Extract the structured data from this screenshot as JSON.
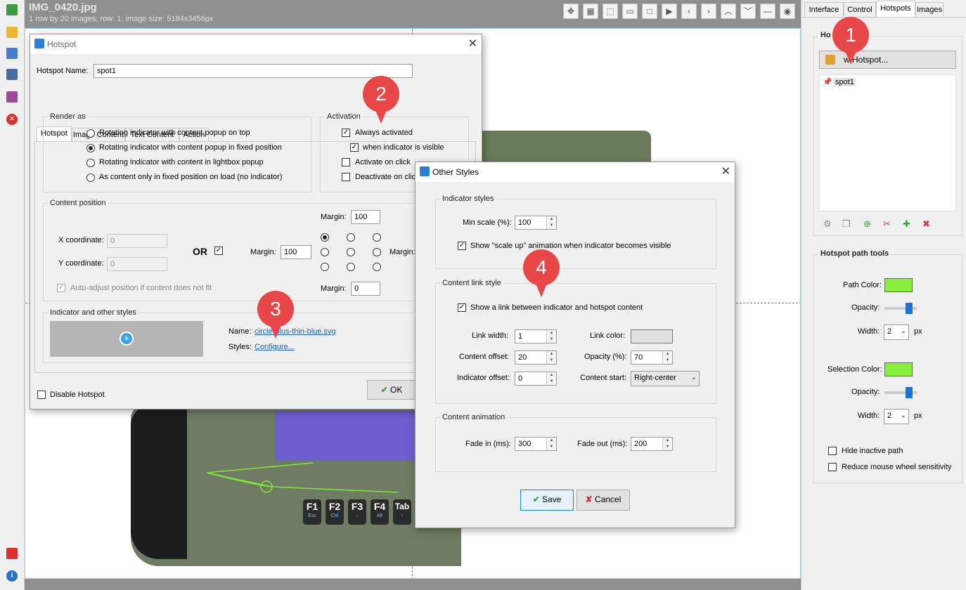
{
  "header": {
    "file_title": "IMG_0420.jpg",
    "file_info": "1 row by 20 images; row: 1; image size: 5184x3456px"
  },
  "right_panel": {
    "tabs": [
      "Interface",
      "Control",
      "Hotspots",
      "Images"
    ],
    "active_tab": "Hotspots",
    "hotspots_group_title": "Ho",
    "new_hotspot_label": "w Hotspot...",
    "hotspot_list": [
      "spot1"
    ],
    "path_tools_title": "Hotspot path tools",
    "path_color_label": "Path Color:",
    "path_color": "#86f03a",
    "opacity_label": "Opacity:",
    "width_label": "Width:",
    "path_width": "2",
    "px_label": "px",
    "selection_color_label": "Selection Color:",
    "selection_color": "#86f03a",
    "selection_width": "2",
    "hide_inactive_label": "Hide inactive path",
    "reduce_wheel_label": "Reduce mouse wheel sensitivity"
  },
  "hotspot_dialog": {
    "title": "Hotspot",
    "name_label": "Hotspot Name:",
    "name_value": "spot1",
    "tabs": [
      "Hotspot",
      "Image Content",
      "Text Content",
      "Action"
    ],
    "render_as_title": "Render as",
    "render_options": [
      "Rotating indicator with content popup on top",
      "Rotating indicator with content popup in fixed position",
      "Rotating indicator with content in lightbox popup",
      "As content only in fixed position on load (no indicator)"
    ],
    "activation_title": "Activation",
    "always_activated": "Always activated",
    "when_visible": "when indicator is visible",
    "activate_click": "Activate on click",
    "deactivate_click": "Deactivate on clic",
    "content_position_title": "Content position",
    "x_label": "X coordinate:",
    "x_value": "0",
    "y_label": "Y coordinate:",
    "y_value": "0",
    "or_label": "OR",
    "margin_label": "Margin:",
    "margin_top": "100",
    "margin_left": "100",
    "margin_bottom": "0",
    "auto_adjust": "Auto-adjust position if content does not fit",
    "indicator_title": "Indicator and other styles",
    "name_field_label": "Name:",
    "indicator_name": "circle-plus-thin-blue.svg",
    "styles_label": "Styles:",
    "configure_link": "Configure...",
    "disable_label": "Disable Hotspot",
    "ok_label": "OK"
  },
  "styles_dialog": {
    "title": "Other Styles",
    "indicator_styles_title": "Indicator styles",
    "min_scale_label": "Min scale (%):",
    "min_scale": "100",
    "scale_up_label": "Show \"scale up\" animation when indicator becomes visible",
    "content_link_title": "Content link style",
    "show_link_label": "Show a link between indicator and hotspot content",
    "link_width_label": "Link width:",
    "link_width": "1",
    "link_color_label": "Link color:",
    "content_offset_label": "Content offset:",
    "content_offset": "20",
    "opacity_label": "Opacity (%):",
    "opacity": "70",
    "indicator_offset_label": "Indicator offset:",
    "indicator_offset": "0",
    "content_start_label": "Content start:",
    "content_start": "Right-center",
    "content_animation_title": "Content animation",
    "fade_in_label": "Fade in (ms):",
    "fade_in": "300",
    "fade_out_label": "Fade out (ms):",
    "fade_out": "200",
    "save_label": "Save",
    "cancel_label": "Cancel"
  },
  "keys": [
    {
      "top": "F1",
      "sub": "Esc"
    },
    {
      "top": "F2",
      "sub": "Ctrl"
    },
    {
      "top": "F3",
      "sub": "↓"
    },
    {
      "top": "F4",
      "sub": "Alt"
    },
    {
      "top": "Tab",
      "sub": "↑"
    }
  ],
  "callouts": [
    "1",
    "2",
    "3",
    "4"
  ]
}
